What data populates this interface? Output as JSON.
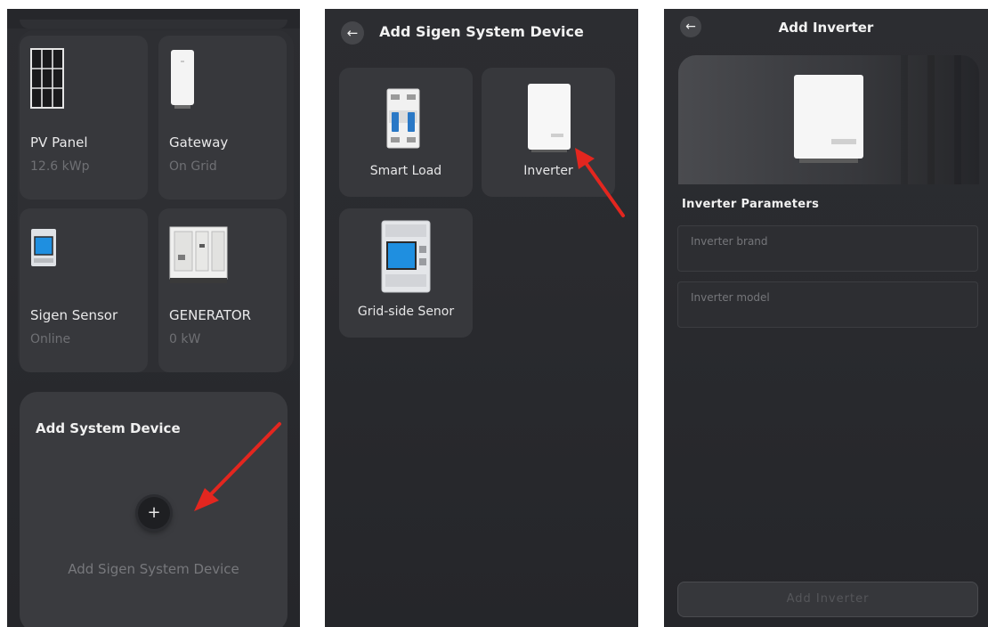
{
  "panel1": {
    "devices": [
      {
        "name": "PV Panel",
        "status": "12.6 kWp",
        "icon": "pv-panel-icon"
      },
      {
        "name": "Gateway",
        "status": "On Grid",
        "icon": "gateway-icon"
      },
      {
        "name": "Sigen Sensor",
        "status": "Online",
        "icon": "sensor-icon"
      },
      {
        "name": "GENERATOR",
        "status": "0 kW",
        "icon": "generator-icon"
      }
    ],
    "add_card": {
      "title": "Add System Device",
      "plus": "+",
      "subtitle": "Add Sigen System Device"
    }
  },
  "panel2": {
    "back_icon": "←",
    "title": "Add Sigen System Device",
    "options": [
      {
        "label": "Smart Load",
        "icon": "circuit-breaker-icon"
      },
      {
        "label": "Inverter",
        "icon": "inverter-icon"
      },
      {
        "label": "Grid-side Senor",
        "icon": "meter-icon"
      }
    ]
  },
  "panel3": {
    "back_icon": "←",
    "title": "Add Inverter",
    "section_title": "Inverter Parameters",
    "brand_placeholder": "Inverter brand",
    "model_placeholder": "Inverter model",
    "submit_label": "Add Inverter"
  },
  "colors": {
    "background": "#2a2b2f",
    "card": "#37383c",
    "annotation_arrow": "#e3261f"
  }
}
